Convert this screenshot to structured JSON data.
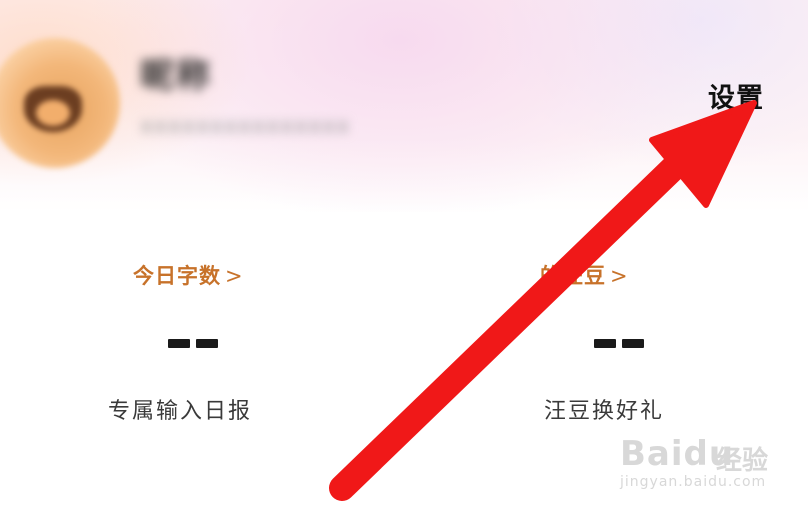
{
  "header": {
    "username": "昵称",
    "user_subline": "xxxxxxxxxxxxxxx",
    "settings_label": "设置"
  },
  "stats": [
    {
      "title": "今日字数",
      "chevron": ">",
      "value": "--",
      "desc": "专属输入日报"
    },
    {
      "title": "的汪豆",
      "chevron": ">",
      "value": "--",
      "desc": "汪豆换好礼"
    }
  ],
  "annotation": {
    "arrow_color": "#f01818"
  },
  "watermark": {
    "brand": "Baidu",
    "product": "经验",
    "url": "jingyan.baidu.com"
  },
  "colors": {
    "stat_title": "#c7722a",
    "header_tint": "#fdf0f3"
  }
}
